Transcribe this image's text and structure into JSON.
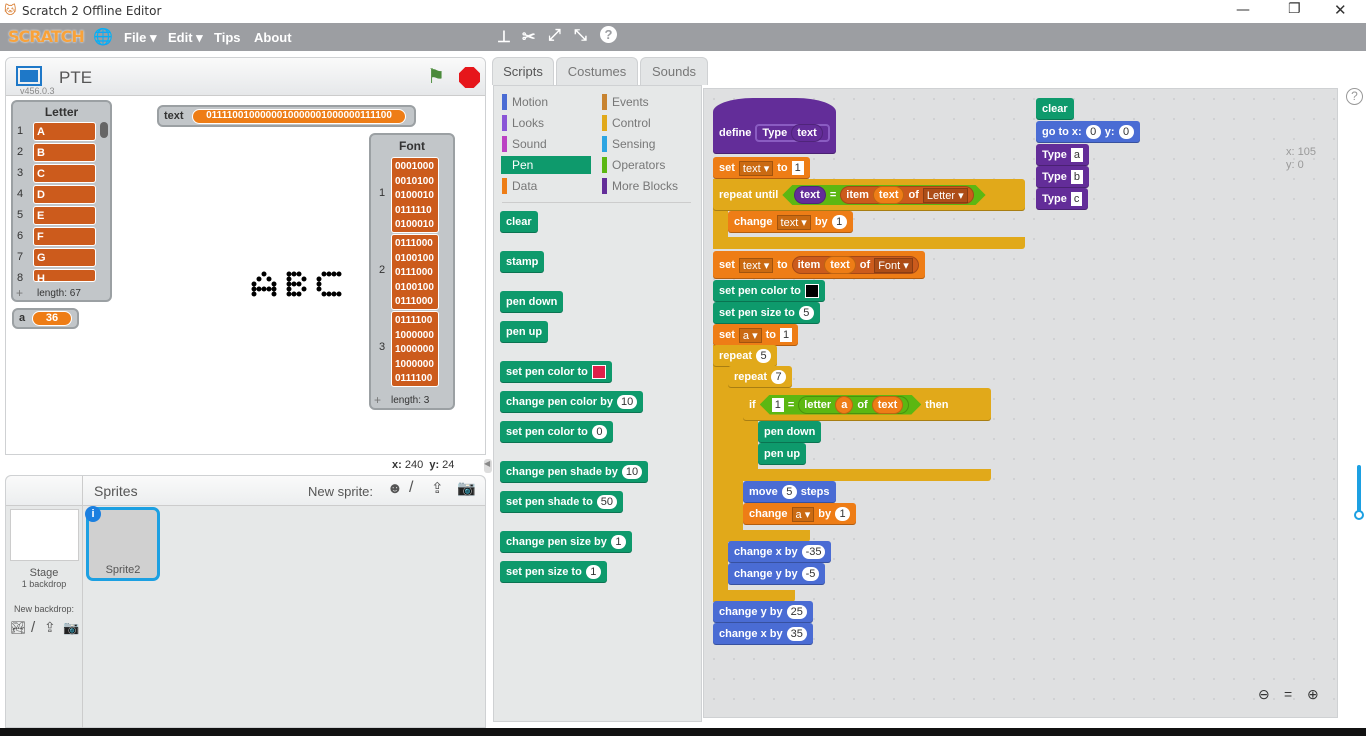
{
  "window": {
    "title": "Scratch 2 Offline Editor"
  },
  "menubar": {
    "logo": "SCRATCH",
    "items": [
      "File ▾",
      "Edit ▾",
      "Tips",
      "About"
    ]
  },
  "stage": {
    "project_name": "PTE",
    "version": "v456.0.3",
    "mouse_x_label": "x:",
    "mouse_x": "240",
    "mouse_y_label": "y:",
    "mouse_y": "24",
    "letter_list": {
      "title": "Letter",
      "items": [
        "A",
        "B",
        "C",
        "D",
        "E",
        "F",
        "G",
        "H"
      ],
      "length": "length: 67"
    },
    "text_var": {
      "label": "text",
      "value": "0111100100000010000001000000111100"
    },
    "a_var": {
      "label": "a",
      "value": "36"
    },
    "font_list": {
      "title": "Font",
      "items": [
        [
          "0001000",
          "0010100",
          "0100010",
          "0111110",
          "0100010"
        ],
        [
          "0111000",
          "0100100",
          "0111000",
          "0100100",
          "0111000"
        ],
        [
          "0111100",
          "1000000",
          "1000000",
          "1000000",
          "0111100"
        ]
      ],
      "length": "length: 3"
    }
  },
  "sprites": {
    "title": "Sprites",
    "new_sprite": "New sprite:",
    "stage_label": "Stage",
    "stage_sub": "1 backdrop",
    "new_backdrop": "New backdrop:",
    "sprite_list": [
      "Sprite2"
    ]
  },
  "tabs": [
    "Scripts",
    "Costumes",
    "Sounds"
  ],
  "categories": [
    {
      "label": "Motion",
      "color": "#4a6cd4"
    },
    {
      "label": "Events",
      "color": "#c88330"
    },
    {
      "label": "Looks",
      "color": "#8a55d7"
    },
    {
      "label": "Control",
      "color": "#e1a91a"
    },
    {
      "label": "Sound",
      "color": "#bb42c3"
    },
    {
      "label": "Sensing",
      "color": "#2ca5e2"
    },
    {
      "label": "Pen",
      "color": "#0e9a6c",
      "selected": true
    },
    {
      "label": "Operators",
      "color": "#5cb712"
    },
    {
      "label": "Data",
      "color": "#ee7d16"
    },
    {
      "label": "More Blocks",
      "color": "#632d99"
    }
  ],
  "palette": [
    [
      "clear"
    ],
    [
      "stamp"
    ],
    [
      "pen down"
    ],
    [
      "pen up"
    ],
    [
      "set pen color to",
      {
        "color": "#e0204a"
      }
    ],
    [
      "change pen color by",
      {
        "num": "10"
      }
    ],
    [
      "set pen color to",
      {
        "num": "0"
      }
    ],
    [
      "change pen shade by",
      {
        "num": "10"
      }
    ],
    [
      "set pen shade to",
      {
        "num": "50"
      }
    ],
    [
      "change pen size by",
      {
        "num": "1"
      }
    ],
    [
      "set pen size to",
      {
        "num": "1"
      }
    ]
  ],
  "scripts": {
    "coords": {
      "x": "x: 105",
      "y": "y: 0"
    },
    "blocks": [
      {
        "c": "more",
        "parts": [
          "define",
          {
            "rep": [
              "Type",
              {
                "rep": [
                  "text"
                ],
                "c": "more"
              }
            ],
            "c": "moreo"
          }
        ]
      },
      {
        "c": "data",
        "parts": [
          "set",
          {
            "dd": "text"
          },
          "to",
          {
            "str": "1"
          }
        ]
      },
      {
        "c": "control",
        "parts": [
          "repeat until",
          {
            "bool": [
              {
                "rep": [
                  "text"
                ],
                "c": "more"
              },
              "=",
              {
                "rep": [
                  "item",
                  {
                    "rep": [
                      "text"
                    ],
                    "c": "data"
                  },
                  "of",
                  {
                    "dd": "Letter"
                  }
                ],
                "c": "list"
              }
            ]
          }
        ]
      },
      {
        "c": "data",
        "parts": [
          "change",
          {
            "dd": "text"
          },
          "by",
          {
            "num": "1"
          }
        ]
      },
      {
        "c": "data",
        "parts": [
          "set",
          {
            "dd": "text"
          },
          "to",
          {
            "rep": [
              "item",
              {
                "rep": [
                  "text"
                ],
                "c": "data"
              },
              "of",
              {
                "dd": "Font"
              }
            ],
            "c": "list"
          }
        ]
      },
      {
        "c": "pen",
        "parts": [
          "set pen color to",
          {
            "color": "#000000"
          }
        ]
      },
      {
        "c": "pen",
        "parts": [
          "set pen size to",
          {
            "num": "5"
          }
        ]
      },
      {
        "c": "data",
        "parts": [
          "set",
          {
            "dd": "a"
          },
          "to",
          {
            "str": "1"
          }
        ]
      },
      {
        "c": "control",
        "parts": [
          "repeat",
          {
            "num": "5"
          }
        ]
      },
      {
        "c": "control",
        "parts": [
          "repeat",
          {
            "num": "7"
          }
        ]
      },
      {
        "c": "control",
        "parts": [
          "if",
          {
            "bool": [
              {
                "str": "1"
              },
              "=",
              {
                "rep": [
                  "letter",
                  {
                    "rep": [
                      "a"
                    ],
                    "c": "data"
                  },
                  "of",
                  {
                    "rep": [
                      "text"
                    ],
                    "c": "data"
                  }
                ],
                "c": "op"
              }
            ]
          },
          "then"
        ]
      },
      {
        "c": "pen",
        "parts": [
          "pen down"
        ]
      },
      {
        "c": "pen",
        "parts": [
          "pen up"
        ]
      },
      {
        "c": "motion",
        "parts": [
          "move",
          {
            "num": "5"
          },
          "steps"
        ]
      },
      {
        "c": "data",
        "parts": [
          "change",
          {
            "dd": "a"
          },
          "by",
          {
            "num": "1"
          }
        ]
      },
      {
        "c": "motion",
        "parts": [
          "change x by",
          {
            "num": "-35"
          }
        ]
      },
      {
        "c": "motion",
        "parts": [
          "change y by",
          {
            "num": "-5"
          }
        ]
      },
      {
        "c": "motion",
        "parts": [
          "change y by",
          {
            "num": "25"
          }
        ]
      },
      {
        "c": "motion",
        "parts": [
          "change x by",
          {
            "num": "35"
          }
        ]
      },
      {
        "c": "pen",
        "parts": [
          "clear"
        ]
      },
      {
        "c": "motion",
        "parts": [
          "go to x:",
          {
            "num": "0"
          },
          "y:",
          {
            "num": "0"
          }
        ]
      },
      {
        "c": "more",
        "parts": [
          "Type",
          {
            "str": "a"
          }
        ]
      },
      {
        "c": "more",
        "parts": [
          "Type",
          {
            "str": "b"
          }
        ]
      },
      {
        "c": "more",
        "parts": [
          "Type",
          {
            "str": "c"
          }
        ]
      }
    ]
  },
  "colors": {
    "motion": "#4a6cd4",
    "data": "#ee7d16",
    "list": "#cc5b1c",
    "control": "#e1a91a",
    "pen": "#0e9a6c",
    "more": "#632d99",
    "moreo": "#632d99",
    "op": "#5cb712"
  }
}
